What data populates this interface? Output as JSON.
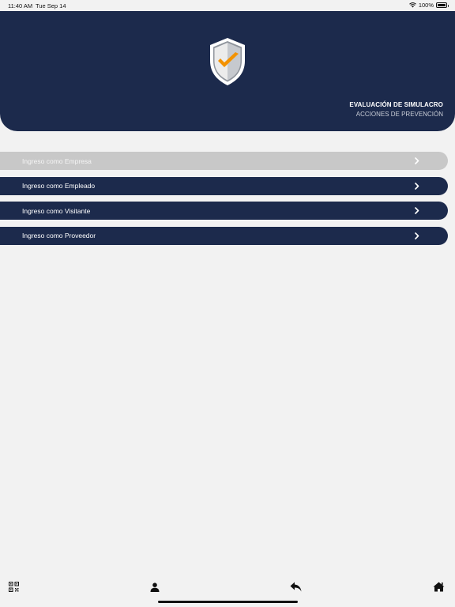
{
  "status_bar": {
    "time": "11:40 AM",
    "date": "Tue Sep 14",
    "battery": "100%"
  },
  "header": {
    "title": "EVALUACIÓN DE SIMULACRO",
    "subtitle": "ACCIONES DE PREVENCIÓN",
    "logo_icon": "shield-check-icon"
  },
  "menu": {
    "items": [
      {
        "label": "Ingreso como Empresa",
        "state": "disabled"
      },
      {
        "label": "Ingreso como Empleado",
        "state": "enabled"
      },
      {
        "label": "Ingreso como Visitante",
        "state": "enabled"
      },
      {
        "label": "Ingreso como Proveedor",
        "state": "enabled"
      }
    ]
  },
  "tabbar": {
    "icons": [
      "qr-code-icon",
      "person-icon",
      "reply-icon",
      "home-icon"
    ]
  },
  "colors": {
    "primary": "#1c2a4c",
    "disabled": "#c8c8c8",
    "accent": "#f39200",
    "background": "#f2f2f2"
  }
}
